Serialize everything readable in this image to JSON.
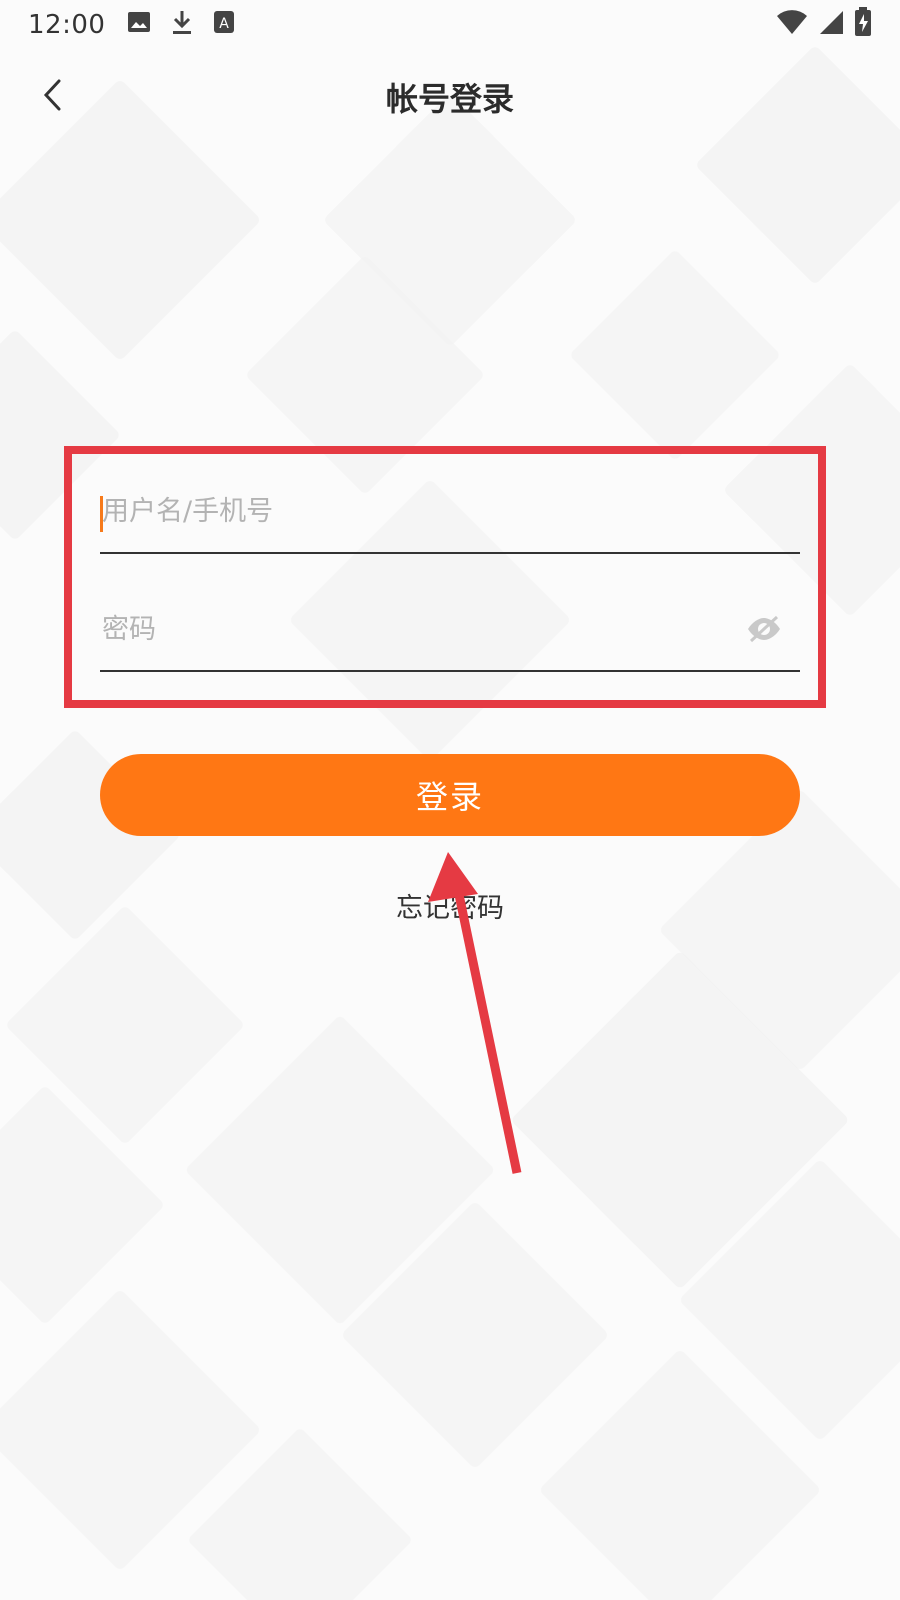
{
  "status_bar": {
    "time": "12:00",
    "icons_left": [
      "image-icon",
      "download-icon",
      "text-a-icon"
    ],
    "icons_right": [
      "wifi-icon",
      "signal-icon",
      "battery-charging-icon"
    ]
  },
  "header": {
    "title": "帐号登录",
    "back_icon": "chevron-left-icon"
  },
  "form": {
    "username_placeholder": "用户名/手机号",
    "username_value": "",
    "password_placeholder": "密码",
    "password_value": "",
    "password_toggle_icon": "eye-off-icon"
  },
  "actions": {
    "login_label": "登录",
    "forgot_label": "忘记密码"
  },
  "colors": {
    "accent": "#ff7714",
    "highlight": "#e53a43",
    "caret": "#f77a1a"
  }
}
